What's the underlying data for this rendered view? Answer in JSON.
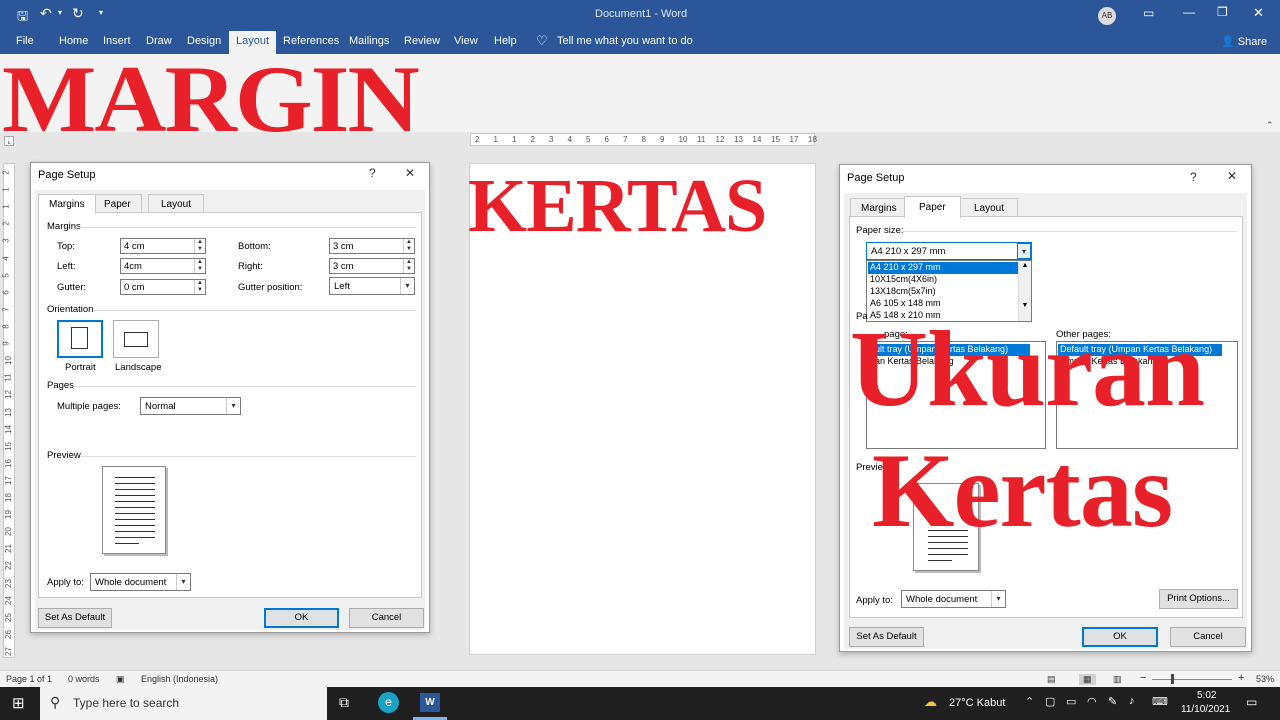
{
  "window": {
    "title": "Document1 - Word",
    "avatar": "AB",
    "minimize_icon": "minimize-icon",
    "restore_icon": "restore-icon",
    "close_icon": "close-icon"
  },
  "quick_access": {
    "save_icon": "save-icon",
    "undo_icon": "undo-icon",
    "redo_icon": "redo-icon"
  },
  "ribbon_tabs": [
    "File",
    "Home",
    "Insert",
    "Draw",
    "Design",
    "Layout",
    "References",
    "Mailings",
    "Review",
    "View",
    "Help"
  ],
  "active_tab": "Layout",
  "tell_me": "Tell me what you want to do",
  "share": "Share",
  "overlay": {
    "margin": "MARGIN",
    "kertas": "KERTAS",
    "ukuran": "Ukuran",
    "kertas2": "Kertas"
  },
  "ruler": {
    "h_labels": [
      "2",
      "1",
      "1",
      "2",
      "3",
      "4",
      "5",
      "6",
      "7",
      "8",
      "9",
      "10",
      "11",
      "12",
      "13",
      "14",
      "15",
      "17",
      "18"
    ],
    "v_labels": [
      "2",
      "1",
      "1",
      "2",
      "3",
      "4",
      "5",
      "6",
      "7",
      "8",
      "9",
      "10",
      "11",
      "12",
      "13",
      "14",
      "15",
      "16",
      "17",
      "18",
      "19",
      "20",
      "21",
      "22",
      "23",
      "24",
      "25",
      "26",
      "27"
    ]
  },
  "dialog_left": {
    "title": "Page Setup",
    "help": "?",
    "close": "✕",
    "tabs": [
      "Margins",
      "Paper",
      "Layout"
    ],
    "sections": {
      "margins": "Margins",
      "orientation": "Orientation",
      "pages": "Pages",
      "preview": "Preview"
    },
    "fields": {
      "top_label": "Top:",
      "top_value": "4 cm",
      "bottom_label": "Bottom:",
      "bottom_value": "3 cm",
      "left_label": "Left:",
      "left_value": "4cm",
      "right_label": "Right:",
      "right_value": "3 cm",
      "gutter_label": "Gutter:",
      "gutter_value": "0 cm",
      "gutter_pos_label": "Gutter position:",
      "gutter_pos_value": "Left"
    },
    "orientation": {
      "portrait": "Portrait",
      "landscape": "Landscape"
    },
    "multiple_pages_label": "Multiple pages:",
    "multiple_pages_value": "Normal",
    "apply_to_label": "Apply to:",
    "apply_to_value": "Whole document",
    "set_default": "Set As Default",
    "ok": "OK",
    "cancel": "Cancel"
  },
  "dialog_right": {
    "title": "Page Setup",
    "help": "?",
    "close": "✕",
    "tabs": [
      "Margins",
      "Paper",
      "Layout"
    ],
    "paper_size_label": "Paper size:",
    "paper_size_value": "A4 210 x 297 mm",
    "paper_size_options": [
      "A4 210 x 297 mm",
      "10X15cm(4X6in)",
      "13X18cm(5x7in)",
      "A6 105 x 148 mm",
      "A5 148 x 210 mm"
    ],
    "pa_label": "Pa",
    "first_page_label": "page:",
    "first_page_items": [
      "ault tray (Umpan Kertas Belakang)",
      "pan Kertas Belakang"
    ],
    "other_pages_label": "Other pages:",
    "other_pages_items": [
      "Default tray (Umpan Kertas Belakang)",
      "Umpan Kertas Belakang"
    ],
    "preview_label": "Previe",
    "apply_to_label": "Apply to:",
    "apply_to_value": "Whole document",
    "print_options": "Print Options...",
    "set_default": "Set As Default",
    "ok": "OK",
    "cancel": "Cancel"
  },
  "status": {
    "page": "Page 1 of 1",
    "words": "0 words",
    "language": "English (Indonesia)",
    "zoom": "53%",
    "minus": "−",
    "plus": "+"
  },
  "taskbar": {
    "search_placeholder": "Type here to search",
    "weather": "27°C  Kabut",
    "time": "5:02",
    "date": "11/10/2021"
  }
}
